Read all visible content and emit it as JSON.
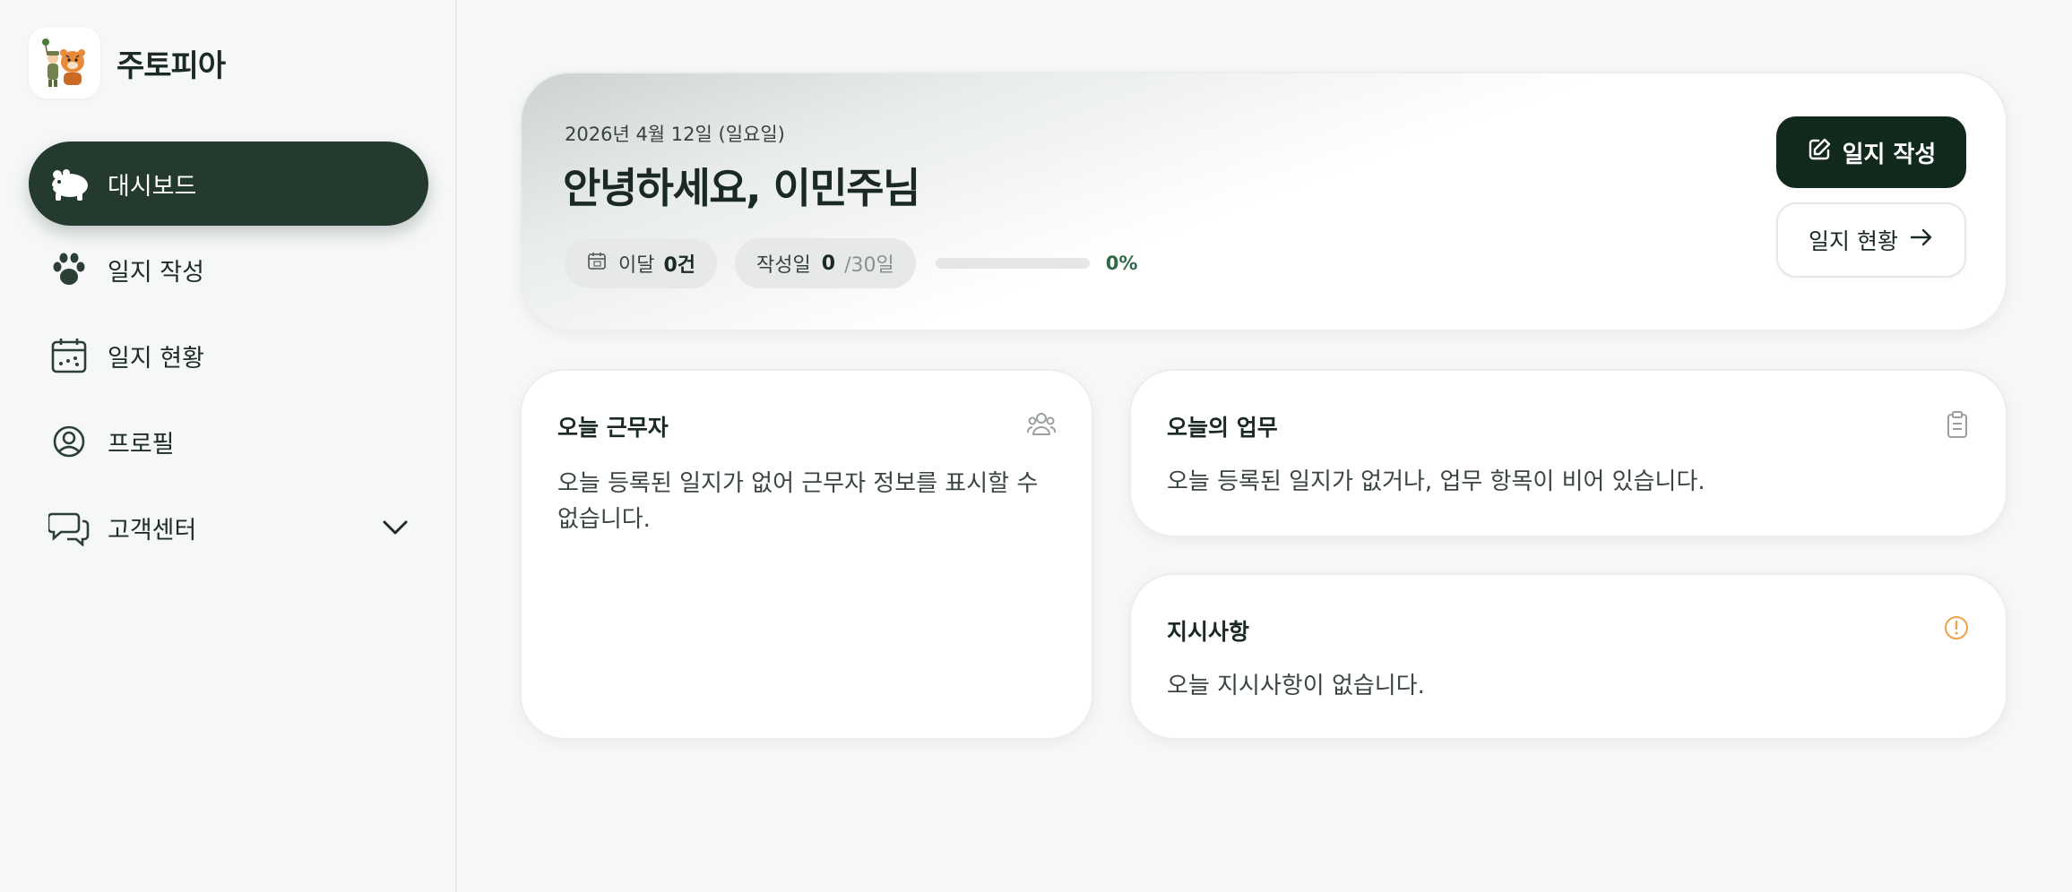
{
  "brand": {
    "name": "주토피아",
    "logo_icon": "animal-mascot-logo"
  },
  "sidebar": {
    "items": [
      {
        "label": "대시보드",
        "icon": "hippo-icon",
        "active": true
      },
      {
        "label": "일지 작성",
        "icon": "paw-icon",
        "active": false
      },
      {
        "label": "일지 현황",
        "icon": "calendar-icon",
        "active": false
      },
      {
        "label": "프로필",
        "icon": "user-circle-icon",
        "active": false
      },
      {
        "label": "고객센터",
        "icon": "chat-bubbles-icon",
        "active": false,
        "expandable": true
      }
    ]
  },
  "hero": {
    "date": "2026년 4월 12일 (일요일)",
    "greeting": "안녕하세요, 이민주님",
    "month_label": "이달",
    "month_value": "0건",
    "written_label": "작성일",
    "written_value": "0",
    "written_total": "/30일",
    "progress_percent": 0,
    "progress_text": "0%",
    "write_button": "일지 작성",
    "status_button": "일지 현황"
  },
  "cards": {
    "workers": {
      "title": "오늘 근무자",
      "body": "오늘 등록된 일지가 없어 근무자 정보를 표시할 수 없습니다.",
      "icon": "users-icon"
    },
    "tasks": {
      "title": "오늘의 업무",
      "body": "오늘 등록된 일지가 없거나, 업무 항목이 비어 있습니다.",
      "icon": "clipboard-icon"
    },
    "notice": {
      "title": "지시사항",
      "body": "오늘 지시사항이 없습니다.",
      "icon": "alert-circle-icon"
    }
  },
  "colors": {
    "accent": "#243a2e",
    "primary_button": "#12291e",
    "progress": "#2f6a48",
    "alert": "#f0a04b"
  }
}
